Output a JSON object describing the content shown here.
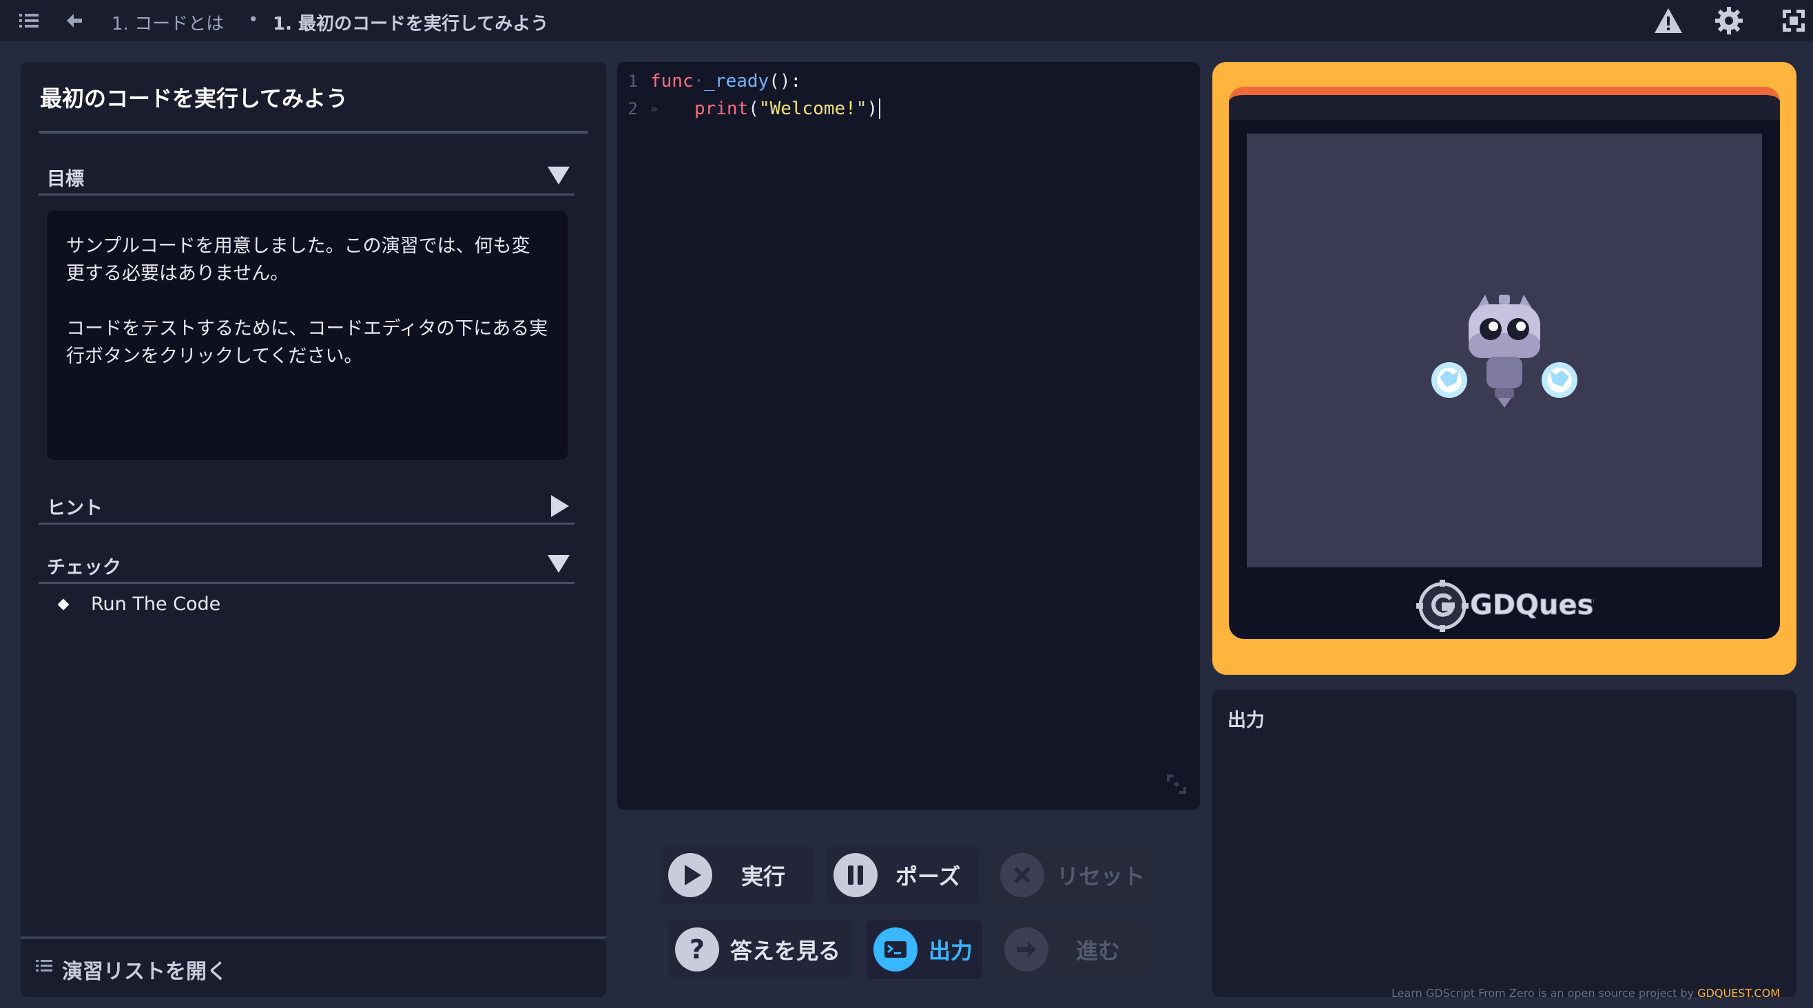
{
  "topbar": {
    "breadcrumb_lesson": "1. コードとは",
    "breadcrumb_separator": "•",
    "breadcrumb_practice": "1. 最初のコードを実行してみよう",
    "icons": [
      "menu-icon",
      "back-arrow-icon",
      "warning-icon",
      "gear-icon",
      "fullscreen-icon"
    ]
  },
  "practice": {
    "title": "最初のコードを実行してみよう",
    "goal_label": "目標",
    "goal_text_1": "サンプルコードを用意しました。この演習では、何も変更する必要はありません。",
    "goal_text_2": "コードをテストするために、コードエディタの下にある実行ボタンをクリックしてください。",
    "hint_label": "ヒント",
    "check_label": "チェック",
    "checks": [
      "Run The Code"
    ],
    "footer_label": "演習リストを開く"
  },
  "editor": {
    "lines": [
      {
        "num": "1",
        "kw": "func",
        "dot": "·",
        "fn": "_ready",
        "rest": "():"
      },
      {
        "num": "2",
        "tab": "»",
        "fn": "print",
        "open": "(",
        "str": "\"Welcome!\"",
        "close": ")"
      }
    ]
  },
  "buttons": {
    "run": "実行",
    "pause": "ポーズ",
    "reset": "リセット",
    "solution": "答えを見る",
    "output": "出力",
    "next": "進む"
  },
  "output_panel": {
    "title": "出力"
  },
  "preview": {
    "logo_text": "GDQuest"
  },
  "credit": {
    "text": "Learn GDScript From Zero is an open source project by ",
    "brand": "GDQUEST.COM"
  },
  "colors": {
    "accent_orange": "#ffb43d",
    "active_blue": "#38b6ff",
    "keyword_red": "#ff6b7f",
    "string_yellow": "#f2e27a"
  }
}
